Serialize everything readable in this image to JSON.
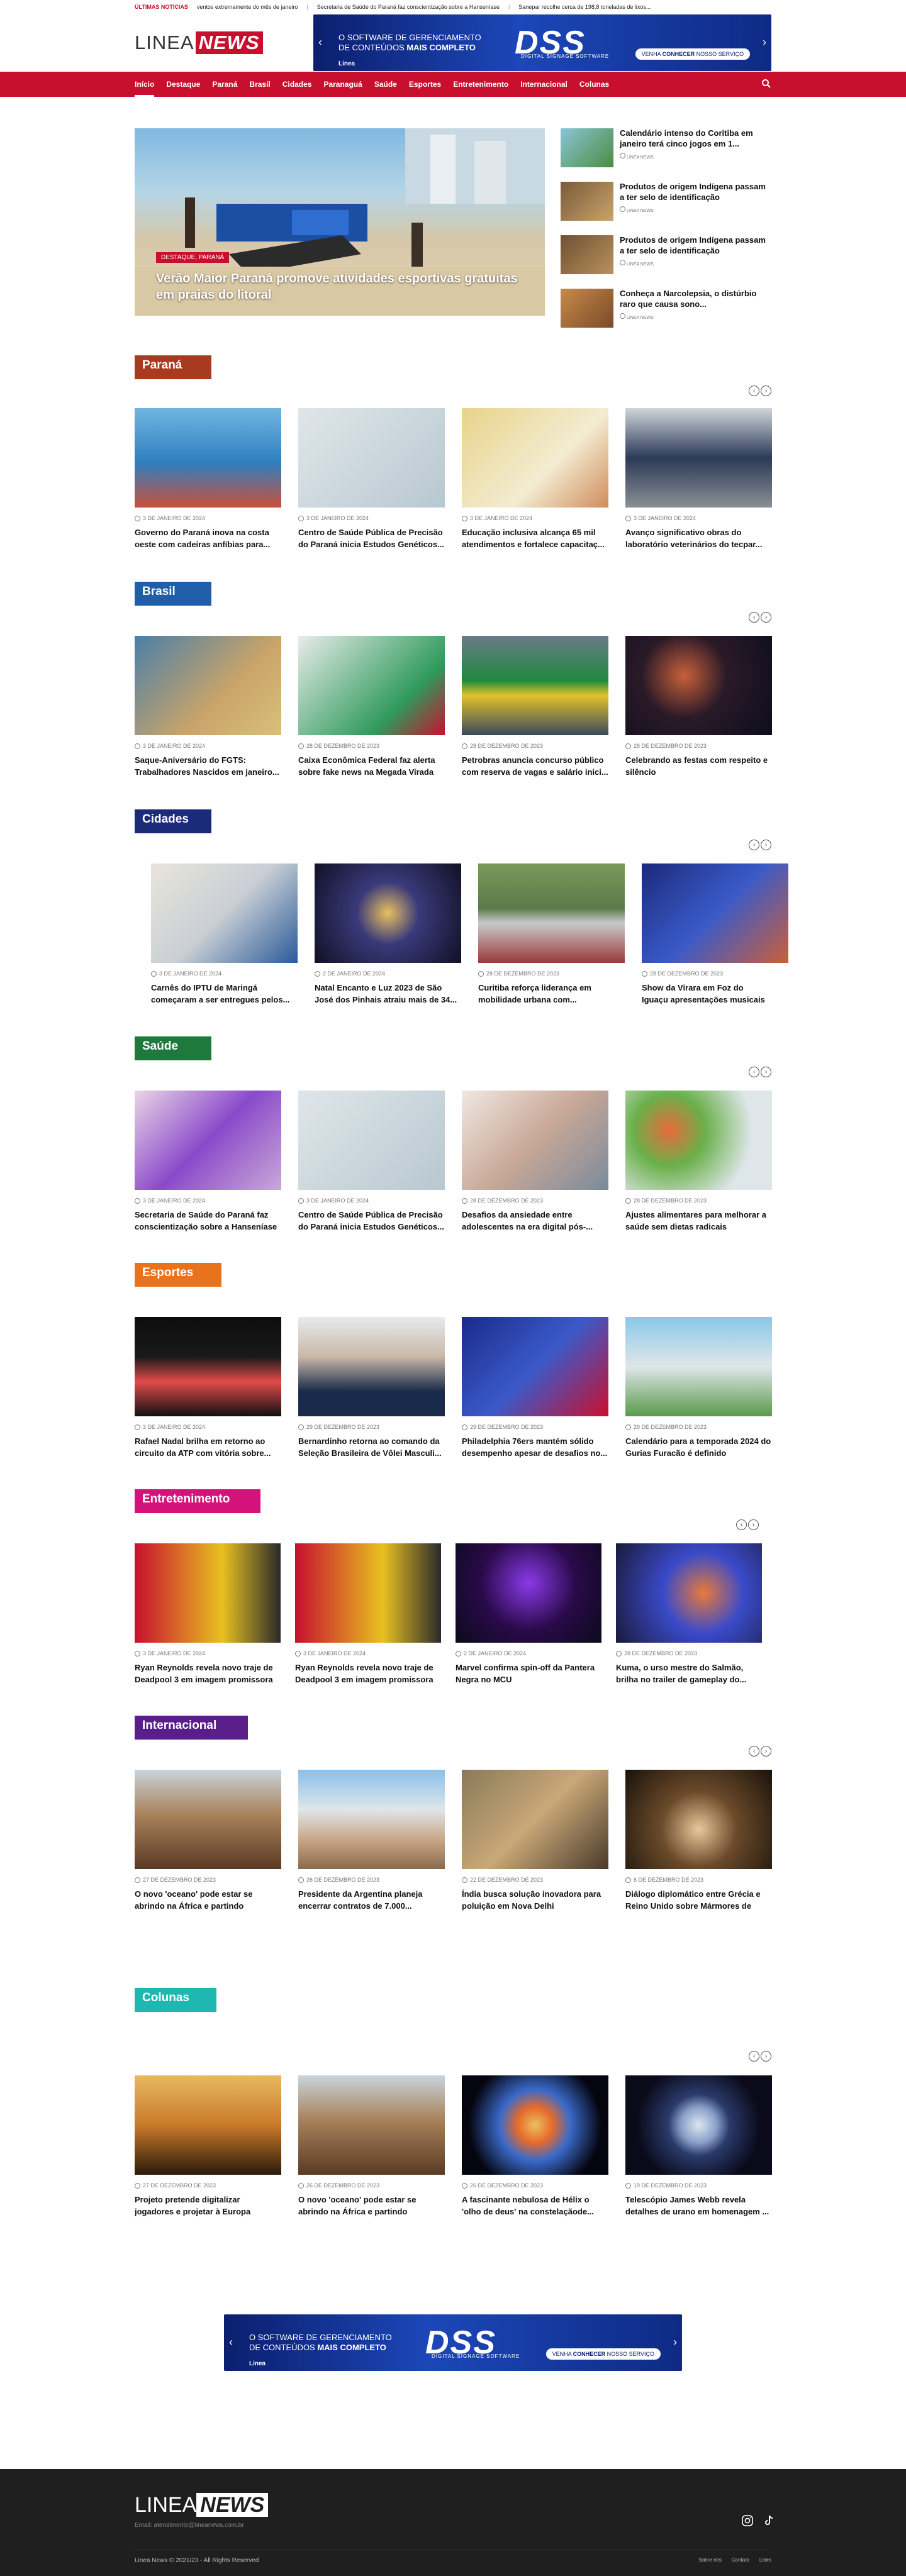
{
  "ticker": {
    "label": "ÚLTIMAS NOTÍCIAS",
    "items": [
      "ventos extremamente do mês de janeiro",
      "Secretaria de Saúde do Paraná faz conscientização sobre a Hanseníase",
      "Sanepar recolhe cerca de 198,8 toneladas de lixos..."
    ]
  },
  "logo": {
    "part1": "LINEA",
    "part2": "NEWS"
  },
  "banner": {
    "line1": "O SOFTWARE DE GERENCIAMENTO",
    "line2a": "DE CONTEÚDOS ",
    "line2b": "MAIS COMPLETO",
    "big": "DSS",
    "sub": "DIGITAL SIGNAGE SOFTWARE",
    "cta1": "VENHA ",
    "cta2": "CONHECER",
    "cta3": " NOSSO SERVIÇO",
    "brand": "Linea"
  },
  "nav": [
    "Início",
    "Destaque",
    "Paraná",
    "Brasil",
    "Cidades",
    "Paranaguá",
    "Saúde",
    "Esportes",
    "Entretenimento",
    "Internacional",
    "Colunas"
  ],
  "hero": {
    "category": "DESTAQUE, PARANÁ",
    "title": "Verão Maior Paraná promove atividades esportivas gratuitas em praias do litoral"
  },
  "side": [
    {
      "title": "Calendário intenso do Coritiba em janeiro terá cinco jogos em 1...",
      "meta": "LINEA NEWS"
    },
    {
      "title": "Produtos de origem Indígena passam a ter selo de identificação",
      "meta": "LINEA NEWS"
    },
    {
      "title": "Produtos de origem Indígena passam a ter selo de identificação",
      "meta": "LINEA NEWS"
    },
    {
      "title": "Conheça a Narcolepsia, o distúrbio raro que causa sono...",
      "meta": "LINEA NEWS"
    }
  ],
  "sections": [
    {
      "name": "Paraná",
      "color": "#a83a20",
      "cards": [
        {
          "date": "3 DE JANEIRO DE 2024",
          "title": "Governo do Paraná inova na costa oeste com cadeiras anfíbias para..."
        },
        {
          "date": "3 DE JANEIRO DE 2024",
          "title": "Centro de Saúde Pública de Precisão do Paraná inicia Estudos Genéticos..."
        },
        {
          "date": "3 DE JANEIRO DE 2024",
          "title": "Educação inclusiva alcança 65 mil atendimentos e fortalece capacitaç..."
        },
        {
          "date": "3 DE JANEIRO DE 2024",
          "title": "Avanço significativo obras do laboratório veterinários do tecpar..."
        }
      ]
    },
    {
      "name": "Brasil",
      "color": "#1f5fa8",
      "cards": [
        {
          "date": "3 DE JANEIRO DE 2024",
          "title": "Saque-Aniversário do FGTS: Trabalhadores Nascidos em janeiro..."
        },
        {
          "date": "28 DE DEZEMBRO DE 2023",
          "title": "Caixa Econômica Federal faz alerta sobre fake news na Megada Virada"
        },
        {
          "date": "28 DE DEZEMBRO DE 2023",
          "title": "Petrobras anuncia concurso público com reserva de vagas e salário inici..."
        },
        {
          "date": "28 DE DEZEMBRO DE 2023",
          "title": "Celebrando as festas com respeito e silêncio"
        }
      ]
    },
    {
      "name": "Cidades",
      "color": "#1c2a7a",
      "cards": [
        {
          "date": "3 DE JANEIRO DE 2024",
          "title": "Carnês do IPTU de Maringá começaram a ser entregues pelos..."
        },
        {
          "date": "2 DE JANEIRO DE 2024",
          "title": "Natal Encanto e Luz 2023 de São José dos Pinhais atraiu mais de 34..."
        },
        {
          "date": "28 DE DEZEMBRO DE 2023",
          "title": "Curitiba reforça liderança em mobilidade urbana com..."
        },
        {
          "date": "28 DE DEZEMBRO DE 2023",
          "title": "Show da Virara em Foz do Iguaçu apresentações musicais e diversã..."
        }
      ]
    },
    {
      "name": "Saúde",
      "color": "#1e7a3c",
      "cards": [
        {
          "date": "3 DE JANEIRO DE 2024",
          "title": "Secretaria de Saúde do Paraná faz conscientização sobre a Hanseníase"
        },
        {
          "date": "3 DE JANEIRO DE 2024",
          "title": "Centro de Saúde Pública de Precisão do Paraná inicia Estudos Genéticos..."
        },
        {
          "date": "28 DE DEZEMBRO DE 2023",
          "title": "Desafios da ansiedade entre adolescentes na era digital pós-..."
        },
        {
          "date": "28 DE DEZEMBRO DE 2023",
          "title": "Ajustes alimentares para melhorar a saúde sem dietas radicais"
        }
      ]
    },
    {
      "name": "Esportes",
      "color": "#e8731c",
      "cards": [
        {
          "date": "3 DE JANEIRO DE 2024",
          "title": "Rafael Nadal brilha em retorno ao circuito da ATP com vitória sobre..."
        },
        {
          "date": "29 DE DEZEMBRO DE 2023",
          "title": "Bernardinho retorna ao comando da Seleção Brasileira de Vôlei Masculi..."
        },
        {
          "date": "29 DE DEZEMBRO DE 2023",
          "title": "Philadelphia 76ers mantém sólido desempenho apesar de desafios no..."
        },
        {
          "date": "29 DE DEZEMBRO DE 2023",
          "title": "Calendário para a temporada 2024 do Gurias Furacão é definido"
        }
      ]
    },
    {
      "name": "Entretenimento",
      "color": "#d4127a",
      "cards": [
        {
          "date": "3 DE JANEIRO DE 2024",
          "title": "Ryan Reynolds revela novo traje de Deadpool 3 em imagem promissora"
        },
        {
          "date": "3 DE JANEIRO DE 2024",
          "title": "Ryan Reynolds revela novo traje de Deadpool 3 em imagem promissora"
        },
        {
          "date": "2 DE JANEIRO DE 2024",
          "title": "Marvel confirma spin-off da Pantera Negra no MCU"
        },
        {
          "date": "28 DE DEZEMBRO DE 2023",
          "title": "Kuma, o urso mestre do Salmão, brilha no trailer de gameplay do..."
        }
      ]
    },
    {
      "name": "Internacional",
      "color": "#5a1e8a",
      "cards": [
        {
          "date": "27 DE DEZEMBRO DE 2023",
          "title": "O novo 'oceano' pode estar se abrindo na África e partindo continente"
        },
        {
          "date": "26 DE DEZEMBRO DE 2023",
          "title": "Presidente da Argentina planeja encerrar contratos de 7.000..."
        },
        {
          "date": "22 DE DEZEMBRO DE 2023",
          "title": "Índia busca solução inovadora para poluição em Nova Delhi"
        },
        {
          "date": "6 DE DEZEMBRO DE 2023",
          "title": "Diálogo diplomático entre Grécia e Reino Unido sobre Mármores de Elg..."
        }
      ]
    },
    {
      "name": "Colunas",
      "color": "#1fb8b0",
      "cards": [
        {
          "date": "27 DE DEZEMBRO DE 2023",
          "title": "Projeto pretende digitalizar jogadores e projetar à Europa"
        },
        {
          "date": "26 DE DEZEMBRO DE 2023",
          "title": "O novo 'oceano' pode estar se abrindo na África e partindo continente"
        },
        {
          "date": "26 DE DEZEMBRO DE 2023",
          "title": "A fascinante nebulosa de Hélix o 'olho de deus' na constelaçãode..."
        },
        {
          "date": "19 DE DEZEMBRO DE 2023",
          "title": "Telescópio James Webb revela detalhes de urano em homenagem ..."
        }
      ]
    }
  ],
  "footer": {
    "email": "Email: atendimento@lineanews.com.br",
    "copy": "Linea News © 2021/23 - All Rights Reserved",
    "links": [
      "Sobre nós",
      "Contato",
      "Lines"
    ]
  }
}
